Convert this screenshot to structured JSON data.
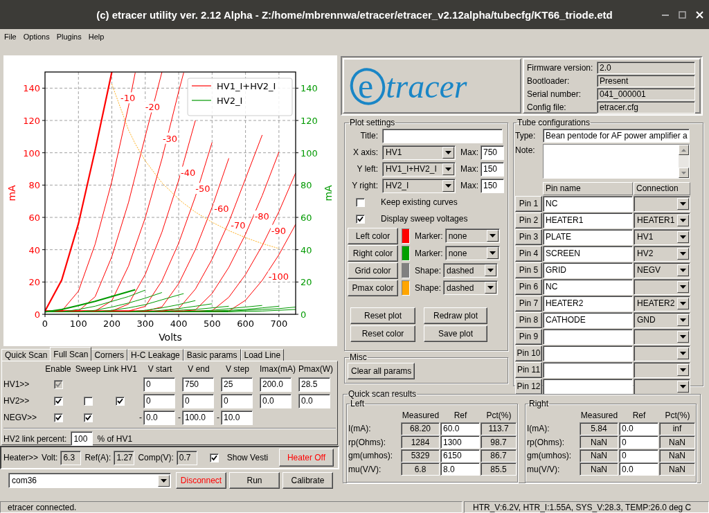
{
  "window": {
    "title": "(c) etracer utility ver. 2.12 Alpha - Z:/home/mbrennwa/etracer/etracer_v2.12alpha/tubecfg/KT66_triode.etd"
  },
  "menu": [
    "File",
    "Options",
    "Plugins",
    "Help"
  ],
  "plot": {
    "chart_data": {
      "type": "line",
      "xlabel": "Volts",
      "ylabel": "mA",
      "y2label": "mA",
      "x": [
        0,
        50,
        100,
        150,
        200,
        250,
        270,
        300,
        350,
        400,
        415,
        450,
        500,
        550,
        600,
        650,
        700,
        750
      ],
      "xlim": [
        0,
        750
      ],
      "ylim": [
        0,
        150
      ],
      "y2lim": [
        0,
        150
      ],
      "grid": true,
      "legend": true,
      "xticks": [
        0,
        100,
        200,
        300,
        400,
        500,
        600,
        700
      ],
      "yticks": [
        0,
        20,
        40,
        60,
        80,
        100,
        120,
        140
      ],
      "y2ticks": [
        0,
        20,
        40,
        60,
        80,
        100,
        120,
        140
      ],
      "series": [
        {
          "name": "HV1_I+HV2_I",
          "color": "#ff0000",
          "values": [
            2,
            21.2,
            56.2,
            101.6,
            150,
            null,
            null,
            null,
            null,
            null,
            null,
            null,
            null,
            null,
            null,
            null,
            null,
            null
          ]
        },
        {
          "color": "#ff0000",
          "values": [
            2,
            2,
            14.3,
            43.4,
            82.3,
            129,
            149.6,
            null,
            null,
            null,
            null,
            null,
            null,
            null,
            null,
            null,
            null,
            null
          ]
        },
        {
          "color": "#ff0000",
          "values": [
            2,
            2,
            2,
            10.9,
            35.7,
            69.4,
            85.7,
            110.2,
            150,
            null,
            null,
            null,
            null,
            null,
            null,
            null,
            null,
            null
          ]
        },
        {
          "color": "#ff0000",
          "values": [
            2,
            2,
            2,
            2,
            8.4,
            29.9,
            41.9,
            59.8,
            96.2,
            138,
            149.6,
            null,
            null,
            null,
            null,
            null,
            null,
            null
          ]
        },
        {
          "color": "#ff0000",
          "values": [
            2,
            2,
            2,
            2,
            2,
            6.4,
            13.7,
            24.7,
            50.9,
            83,
            94.1,
            120,
            null,
            null,
            null,
            null,
            null,
            null
          ]
        },
        {
          "color": "#ff0000",
          "values": [
            2,
            2,
            2,
            2,
            2,
            2,
            3.2,
            4.9,
            20.7,
            44.1,
            52.7,
            72.9,
            106.4,
            null,
            null,
            null,
            null,
            null
          ]
        },
        {
          "color": "#ff0000",
          "values": [
            2,
            2,
            2,
            2,
            2,
            2,
            2,
            2,
            4.6,
            19,
            25.3,
            40.1,
            66.3,
            96.6,
            null,
            null,
            null,
            null
          ]
        },
        {
          "color": "#ff0000",
          "values": [
            2,
            2,
            2,
            2,
            2,
            2,
            2,
            2,
            2,
            3.5,
            7.1,
            15.6,
            34.1,
            57.1,
            84,
            111,
            null,
            null
          ]
        },
        {
          "color": "#ff0000",
          "values": [
            2,
            2,
            2,
            2,
            2,
            2,
            2,
            2,
            2,
            2,
            2,
            2.7,
            12.9,
            29.1,
            49.6,
            73.5,
            100.5,
            null
          ]
        },
        {
          "color": "#ff0000",
          "values": [
            2,
            2,
            2,
            2,
            2,
            2,
            2,
            2,
            2,
            2,
            2,
            2,
            2.2,
            10.6,
            24.6,
            42.5,
            63.6,
            87.5
          ]
        },
        {
          "color": "#ff0000",
          "values": [
            2,
            2,
            2,
            2,
            2,
            2,
            2,
            2,
            2,
            2,
            2,
            2,
            2,
            2,
            8.7,
            21,
            36.9,
            55.7
          ]
        },
        {
          "name": "HV2_I",
          "color": "#009900",
          "axis": "y2",
          "values": [
            1.5,
            3,
            5.5,
            8,
            11,
            14,
            15.2,
            null,
            null,
            null,
            null,
            null,
            null,
            null,
            null,
            null,
            null,
            null
          ]
        },
        {
          "color": "#009900",
          "axis": "y2",
          "values": [
            1.5,
            1.5,
            3,
            5,
            8,
            11,
            12.6,
            15,
            null,
            null,
            null,
            null,
            null,
            null,
            null,
            null,
            null,
            null
          ]
        },
        {
          "color": "#009900",
          "axis": "y2",
          "values": [
            1.5,
            1.5,
            1.5,
            2.5,
            4.5,
            7,
            8.2,
            10,
            13.5,
            null,
            null,
            null,
            null,
            null,
            null,
            null,
            null,
            null
          ]
        },
        {
          "color": "#009900",
          "axis": "y2",
          "values": [
            1.5,
            1.5,
            1.5,
            1.5,
            2.5,
            4,
            4.8,
            6,
            9,
            12,
            12.8,
            null,
            null,
            null,
            null,
            null,
            null,
            null
          ]
        },
        {
          "color": "#009900",
          "axis": "y2",
          "values": [
            1.5,
            1.5,
            1.5,
            1.5,
            1.5,
            1.5,
            1.9,
            2.5,
            4,
            6,
            6.8,
            8.5,
            null,
            null,
            null,
            null,
            null,
            null
          ]
        },
        {
          "color": "#009900",
          "axis": "y2",
          "values": [
            1.5,
            1.5,
            1.5,
            1.5,
            1.5,
            1.5,
            1.5,
            1.5,
            2.5,
            3.5,
            4,
            5,
            6.5,
            null,
            null,
            null,
            null,
            null
          ]
        },
        {
          "color": "#009900",
          "axis": "y2",
          "values": [
            1.5,
            1.5,
            1.5,
            1.5,
            1.5,
            1.5,
            1.5,
            1.5,
            1.5,
            2.5,
            2.7,
            3,
            4,
            5,
            null,
            null,
            null,
            null
          ]
        },
        {
          "color": "#009900",
          "axis": "y2",
          "values": [
            1.5,
            1.5,
            1.5,
            1.5,
            1.5,
            1.5,
            1.5,
            1.5,
            1.5,
            1.5,
            1.7,
            2,
            2.5,
            3.5,
            4.5,
            5.5,
            null,
            null
          ]
        },
        {
          "color": "#009900",
          "axis": "y2",
          "values": [
            1.5,
            1.5,
            1.5,
            1.5,
            1.5,
            1.5,
            1.5,
            1.5,
            1.5,
            1.5,
            1.5,
            1.5,
            2,
            2.5,
            3,
            4,
            5,
            null
          ]
        },
        {
          "color": "#009900",
          "axis": "y2",
          "values": [
            1.5,
            1.5,
            1.5,
            1.5,
            1.5,
            1.5,
            1.5,
            1.5,
            1.5,
            1.5,
            1.5,
            1.5,
            1.5,
            2,
            2.5,
            3,
            3.5,
            4.5
          ]
        },
        {
          "color": "#009900",
          "axis": "y2",
          "values": [
            1.5,
            1.5,
            1.5,
            1.5,
            1.5,
            1.5,
            1.5,
            1.5,
            1.5,
            1.5,
            1.5,
            1.5,
            1.5,
            1.5,
            1.8,
            2,
            2.5,
            3
          ]
        },
        {
          "color": "#ffa500",
          "line_style": "dashed",
          "values": [
            null,
            null,
            null,
            null,
            142.5,
            114,
            105.6,
            95,
            81.4,
            71.3,
            68.7,
            63.3,
            57,
            51.8,
            47.5,
            43.8,
            40.7,
            null
          ]
        }
      ],
      "annotations": [
        {
          "text": "-10",
          "x": 248,
          "y": 134
        },
        {
          "text": "-20",
          "x": 322,
          "y": 128.4
        },
        {
          "text": "-30",
          "x": 374,
          "y": 109
        },
        {
          "text": "-40",
          "x": 428,
          "y": 88
        },
        {
          "text": "-50",
          "x": 472,
          "y": 78
        },
        {
          "text": "-60",
          "x": 528,
          "y": 65.5
        },
        {
          "text": "-70",
          "x": 578,
          "y": 55.5
        },
        {
          "text": "-80",
          "x": 649,
          "y": 60.8
        },
        {
          "text": "-90",
          "x": 699,
          "y": 52
        },
        {
          "text": "-100",
          "x": 699,
          "y": 23.6
        }
      ]
    }
  },
  "scan_tabs": [
    {
      "label": "Quick Scan",
      "selected": false
    },
    {
      "label": "Full Scan",
      "selected": true
    },
    {
      "label": "Corners",
      "selected": false
    },
    {
      "label": "H-C Leakage",
      "selected": false
    },
    {
      "label": "Basic params",
      "selected": false
    },
    {
      "label": "Load Line",
      "selected": false
    }
  ],
  "full_scan": {
    "columns": [
      "Enable",
      "Sweep",
      "Link HV1",
      "V start",
      "V end",
      "V step",
      "Imax(mA)",
      "Pmax(W)"
    ],
    "rows": [
      {
        "label": "HV1>>",
        "enable": {
          "checked": true,
          "disabled": true
        },
        "values": [
          {
            "value": "0"
          },
          {
            "value": "750"
          },
          {
            "value": "25"
          },
          {
            "value": "200.0"
          },
          {
            "value": "28.5"
          }
        ]
      },
      {
        "label": "HV2>>",
        "enable": {
          "checked": true,
          "disabled": false
        },
        "sweep": {
          "checked": false
        },
        "link": {
          "checked": true
        },
        "values": [
          {
            "value": "0"
          },
          {
            "value": "0"
          },
          {
            "value": "0"
          },
          {
            "value": "0.0"
          },
          {
            "value": "0.0"
          }
        ]
      },
      {
        "label": "NEGV>>",
        "enable": {
          "checked": true,
          "disabled": false
        },
        "sweep": {
          "checked": true
        },
        "values": [
          {
            "prefix": "-",
            "value": "0.0"
          },
          {
            "prefix": "-",
            "value": "100.0"
          },
          {
            "prefix": "-",
            "value": "10.0"
          }
        ]
      }
    ],
    "link_percent": {
      "label": "HV2 link percent:",
      "value": "100",
      "suffix": "% of HV1"
    }
  },
  "heater": {
    "label": "Heater>>",
    "fields": [
      {
        "label": "Volt:",
        "value": "6.3"
      },
      {
        "label": "Ref(A):",
        "value": "1.27"
      },
      {
        "label": "Comp(V):",
        "value": "0.7"
      }
    ],
    "show_vesti": {
      "label": "Show Vesti",
      "checked": true
    },
    "button": {
      "label": "Heater Off",
      "kind": "warning"
    }
  },
  "port": {
    "value": "com36"
  },
  "action_buttons": [
    {
      "label": "Disconnect",
      "kind": "warning"
    },
    {
      "label": "Run",
      "kind": "normal"
    },
    {
      "label": "Calibrate",
      "kind": "normal"
    }
  ],
  "logo": {
    "mark": "e",
    "text": "tracer"
  },
  "device_info": [
    {
      "label": "Firmware version:",
      "value": "2.0"
    },
    {
      "label": "Bootloader:",
      "value": "Present"
    },
    {
      "label": "Serial number:",
      "value": "041_000001"
    },
    {
      "label": "Config file:",
      "value": "etracer.cfg"
    }
  ],
  "plot_settings": {
    "title": "Plot settings",
    "title_field": {
      "label": "Title:"
    },
    "axes": [
      {
        "label": "X axis:",
        "value": "HV1",
        "max_label": "Max:",
        "max": "750"
      },
      {
        "label": "Y left:",
        "value": "HV1_I+HV2_I",
        "max_label": "Max:",
        "max": "150"
      },
      {
        "label": "Y right:",
        "value": "HV2_I",
        "max_label": "Max:",
        "max": "150"
      }
    ],
    "options": [
      {
        "label": "Keep existing curves",
        "checked": false
      },
      {
        "label": "Display sweep voltages",
        "checked": true
      }
    ],
    "colors": [
      {
        "button": "Left color",
        "color": "#ff0000",
        "field_label": "Marker:",
        "value": "none"
      },
      {
        "button": "Right color",
        "color": "#00a000",
        "field_label": "Marker:",
        "value": "none"
      },
      {
        "button": "Grid color",
        "color": "#808080",
        "field_label": "Shape:",
        "value": "dashed"
      },
      {
        "button": "Pmax color",
        "color": "#ffa500",
        "field_label": "Shape:",
        "value": "dashed"
      }
    ],
    "buttons": [
      "Reset plot",
      "Redraw plot",
      "Reset color",
      "Save plot"
    ]
  },
  "misc": {
    "title": "Misc",
    "buttons": [
      "Clear all params"
    ]
  },
  "tube": {
    "title": "Tube configurations",
    "type_label": "Type:",
    "type": "Bean pentode for AF power amplifier a",
    "note_label": "Note:",
    "columns": [
      "Pin name",
      "Connection"
    ],
    "pins": [
      {
        "pin": "Pin 1",
        "name": "NC"
      },
      {
        "pin": "Pin 2",
        "name": "HEATER1",
        "connection": "HEATER1"
      },
      {
        "pin": "Pin 3",
        "name": "PLATE",
        "connection": "HV1"
      },
      {
        "pin": "Pin 4",
        "name": "SCREEN",
        "connection": "HV2"
      },
      {
        "pin": "Pin 5",
        "name": "GRID",
        "connection": "NEGV"
      },
      {
        "pin": "Pin 6",
        "name": "NC"
      },
      {
        "pin": "Pin 7",
        "name": "HEATER2",
        "connection": "HEATER2"
      },
      {
        "pin": "Pin 8",
        "name": "CATHODE",
        "connection": "GND"
      },
      {
        "pin": "Pin 9"
      },
      {
        "pin": "Pin 10"
      },
      {
        "pin": "Pin 11"
      },
      {
        "pin": "Pin 12"
      }
    ]
  },
  "quick_scan": {
    "title": "Quick scan results",
    "groups": [
      {
        "title": "Left",
        "columns": [
          "Measured",
          "Ref",
          "Pct(%)"
        ],
        "rows": [
          {
            "label": "I(mA):",
            "measured": "68.20",
            "ref": "60.0",
            "pct": "113.7"
          },
          {
            "label": "rp(Ohms):",
            "measured": "1284",
            "ref": "1300",
            "pct": "98.7"
          },
          {
            "label": "gm(umhos):",
            "measured": "5329",
            "ref": "6150",
            "pct": "86.7"
          },
          {
            "label": "mu(V/V):",
            "measured": "6.8",
            "ref": "8.0",
            "pct": "85.5"
          }
        ]
      },
      {
        "title": "Right",
        "columns": [
          "Measured",
          "Ref",
          "Pct(%)"
        ],
        "rows": [
          {
            "label": "I(mA):",
            "measured": "5.84",
            "ref": "0.0",
            "pct": "inf"
          },
          {
            "label": "rp(Ohms):",
            "measured": "NaN",
            "ref": "0",
            "pct": "NaN"
          },
          {
            "label": "gm(umhos):",
            "measured": "NaN",
            "ref": "0",
            "pct": "NaN"
          },
          {
            "label": "mu(V/V):",
            "measured": "NaN",
            "ref": "0.0",
            "pct": "NaN"
          }
        ]
      }
    ]
  },
  "status_bar": [
    "etracer connected.",
    "HTR_V:6.2V, HTR_I:1.55A, SYS_V:28.3, TEMP:26.0 deg C"
  ]
}
